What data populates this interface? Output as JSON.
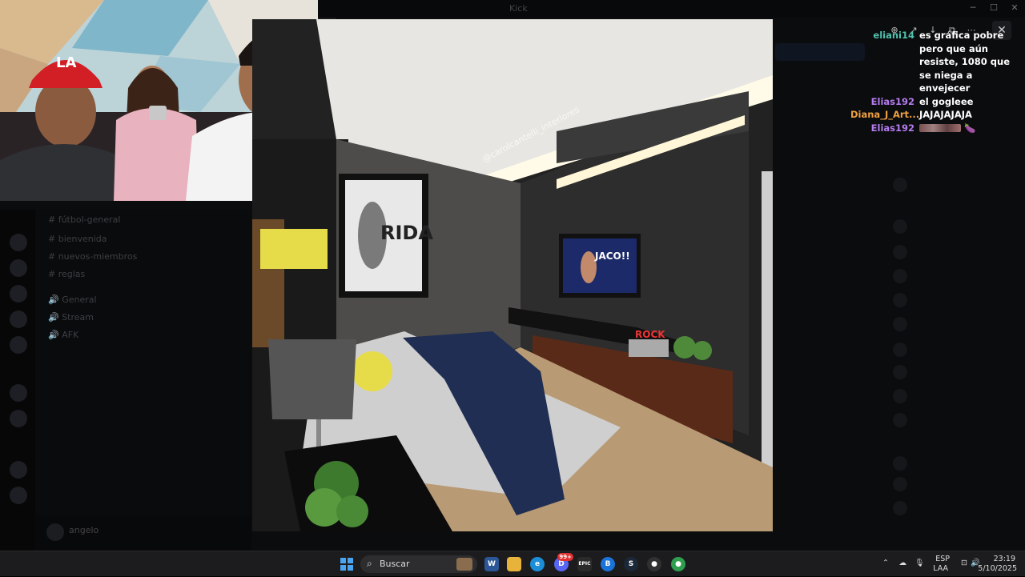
{
  "window": {
    "title": "Kick"
  },
  "discord": {
    "channel_header": "# fútbol-general",
    "channels": [
      "# bienvenida",
      "# nuevos-miembros",
      "# reglas",
      "🔊 General",
      "🔊 Stream",
      "🔊 AFK"
    ],
    "user_name": "angelo"
  },
  "viewer": {
    "watermark": "@carolcantelli_interiores",
    "tv_text": "JACO!!",
    "sign_text": "ROCK",
    "poster_text": "RIDA"
  },
  "chat": {
    "messages": [
      {
        "user": "eliani14",
        "color": "#4fc3ae",
        "text": "es gráfica pobre pero que aún resiste, 1080 que se niega a envejecer"
      },
      {
        "user": "Elias192",
        "color": "#b47cf0",
        "text": "el gogleee"
      },
      {
        "user": "Diana_J_Art...",
        "color": "#f0a040",
        "text": "JAJAJAJAJA"
      },
      {
        "user": "Elias192",
        "color": "#b47cf0",
        "text": "",
        "emotes": true
      }
    ]
  },
  "taskbar": {
    "search_label": "Buscar",
    "apps": [
      {
        "name": "word-icon",
        "label": "W",
        "color": "#2b5797"
      },
      {
        "name": "file-explorer-icon",
        "label": "",
        "color": "#e8b33a"
      },
      {
        "name": "edge-icon",
        "label": "e",
        "color": "#1c8ed8"
      },
      {
        "name": "discord-icon",
        "label": "D",
        "color": "#5865f2",
        "badge": "99+"
      },
      {
        "name": "epic-games-icon",
        "label": "EPIC",
        "color": "#2a2a2a"
      },
      {
        "name": "battle-net-icon",
        "label": "B",
        "color": "#1a73d8"
      },
      {
        "name": "steam-icon",
        "label": "S",
        "color": "#1b2838"
      },
      {
        "name": "obs-icon",
        "label": "●",
        "color": "#303030"
      },
      {
        "name": "chrome-icon",
        "label": "●",
        "color": "#2e9e4f"
      }
    ],
    "lang_top": "ESP",
    "lang_bottom": "LAA",
    "time": "23:19",
    "date": "5/10/2025"
  }
}
